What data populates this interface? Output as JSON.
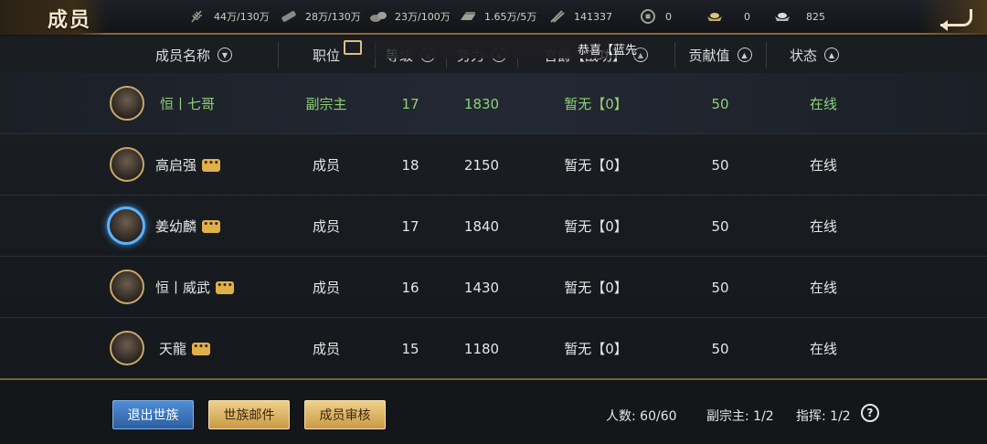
{
  "window": {
    "title": "成员"
  },
  "resources": [
    {
      "icon": "wheat-icon",
      "value": "44万/130万"
    },
    {
      "icon": "wood-icon",
      "value": "28万/130万"
    },
    {
      "icon": "stone-icon",
      "value": "23万/100万"
    },
    {
      "icon": "iron-icon",
      "value": "1.65万/5万"
    },
    {
      "icon": "scroll-icon",
      "value": "141337"
    },
    {
      "icon": "coin-icon",
      "value": "0"
    },
    {
      "icon": "gold-ingot-icon",
      "value": "0"
    },
    {
      "icon": "silver-ingot-icon",
      "value": "825"
    }
  ],
  "columns": {
    "name": "成员名称",
    "role": "职位",
    "level": "等级",
    "power": "势力",
    "rank": "官爵【战功】",
    "contribution": "贡献值",
    "status": "状态"
  },
  "toast": {
    "text": "恭喜【蓝先"
  },
  "members": [
    {
      "name": "恒丨七哥",
      "role": "副宗主",
      "level": "17",
      "power": "1830",
      "rank": "暂无【0】",
      "contribution": "50",
      "status": "在线",
      "chat": false,
      "highlight": true
    },
    {
      "name": "高启强",
      "role": "成员",
      "level": "18",
      "power": "2150",
      "rank": "暂无【0】",
      "contribution": "50",
      "status": "在线",
      "chat": true,
      "highlight": false
    },
    {
      "name": "姜幼麟",
      "role": "成员",
      "level": "17",
      "power": "1840",
      "rank": "暂无【0】",
      "contribution": "50",
      "status": "在线",
      "chat": true,
      "highlight": false
    },
    {
      "name": "恒丨威武",
      "role": "成员",
      "level": "16",
      "power": "1430",
      "rank": "暂无【0】",
      "contribution": "50",
      "status": "在线",
      "chat": true,
      "highlight": false
    },
    {
      "name": "天龍",
      "role": "成员",
      "level": "15",
      "power": "1180",
      "rank": "暂无【0】",
      "contribution": "50",
      "status": "在线",
      "chat": true,
      "highlight": false
    }
  ],
  "buttons": {
    "quit": "退出世族",
    "mail": "世族邮件",
    "review": "成员审核"
  },
  "stats": {
    "count": "人数: 60/60",
    "vice": "副宗主: 1/2",
    "command": "指挥: 1/2",
    "help": "?"
  }
}
